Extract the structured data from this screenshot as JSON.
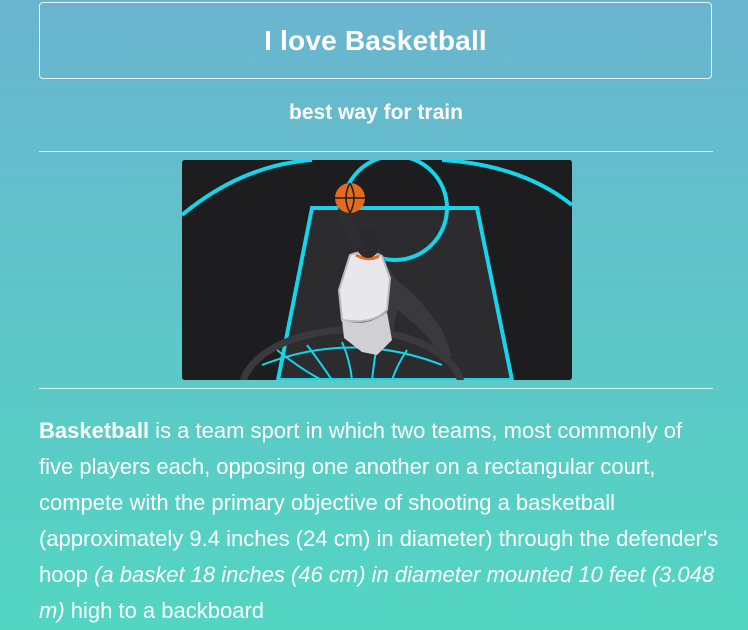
{
  "header": {
    "title": "I love Basketball",
    "subtitle": "best way for train"
  },
  "hero_image": {
    "icon": "basketball-player-dunk-illustration",
    "colors": {
      "court": "#1d1d1f",
      "lines": "#16d4ea",
      "ball": "#e46a1e"
    }
  },
  "article": {
    "lead": "Basketball",
    "text_1": " is a team sport in which two teams, most commonly of five players each, opposing one another on a rectangular court, compete with the primary objective of shooting a basketball (approximately 9.4 inches (24 cm) in diameter) through the defender's hoop ",
    "italic": "(a basket 18 inches (46 cm) in diameter mounted 10 feet (3.048 m)",
    "text_2": " high to a backboard"
  }
}
